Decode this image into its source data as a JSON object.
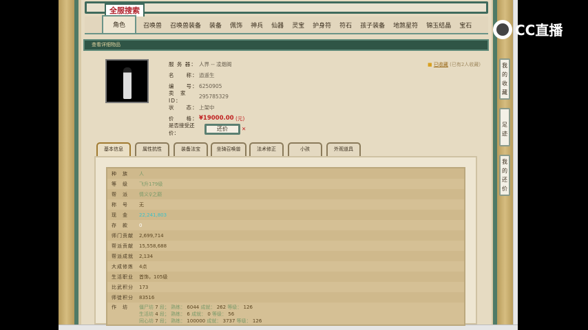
{
  "header": {
    "logo": "全服搜索"
  },
  "tabs": [
    "角色",
    "召唤兽",
    "召唤兽装备",
    "装备",
    "佩饰",
    "神兵",
    "仙器",
    "灵宝",
    "护身符",
    "符石",
    "孩子装备",
    "地煞星符",
    "锦玉结晶",
    "宝石"
  ],
  "active_tab": "角色",
  "section_title": "查看详细物品",
  "favorite": {
    "label": "已收藏",
    "count_text": "(已有2人收藏)"
  },
  "info": [
    {
      "key": "服 务 器：",
      "value": "人界 -- 凌烟阁"
    },
    {
      "key": "名　　称：",
      "value": "逍遥生"
    },
    {
      "key": "编　　号：",
      "value": "6250905"
    },
    {
      "key": "卖　家　ID：",
      "value": "295785329"
    },
    {
      "key": "状　　态：",
      "value": "上架中"
    },
    {
      "key": "价　　格：",
      "value": "¥19000.00",
      "unit": "(元)"
    },
    {
      "key": "是否接受还价：",
      "button": "还价"
    }
  ],
  "detail_tabs": [
    "基本信息",
    "属性抗性",
    "装备法宝",
    "坐骑召唤兽",
    "法术修正",
    "小孩",
    "外观道具"
  ],
  "active_detail_tab": "基本信息",
  "basic": [
    {
      "key": "种　族",
      "value": "人"
    },
    {
      "key": "等　级",
      "value": "飞升179级"
    },
    {
      "key": "帮　派",
      "value": "情义♀之巅"
    },
    {
      "key": "称　号",
      "value": "无"
    },
    {
      "key": "现　金",
      "value": "22,241,803"
    },
    {
      "key": "存　款",
      "value": "0"
    },
    {
      "key": "师门贡献",
      "value": "2,699,714"
    },
    {
      "key": "帮派贡献",
      "value": "15,558,688"
    },
    {
      "key": "帮派成就",
      "value": "2,134"
    },
    {
      "key": "大成修炼",
      "value": "4点"
    },
    {
      "key": "生活职业",
      "value": "首饰，105级"
    },
    {
      "key": "比武积分",
      "value": "173"
    },
    {
      "key": "师徒积分",
      "value": "83516"
    }
  ],
  "workshop": {
    "key": "作　坊",
    "lines": [
      [
        "僵尸坊",
        "7",
        "6044",
        "262",
        "126"
      ],
      [
        "生活坊",
        "4",
        "6",
        "0",
        "56"
      ],
      [
        "同心坊",
        "7",
        "100000",
        "3737",
        "126"
      ]
    ],
    "labels": {
      "grade": "段；",
      "skill": "熟练：",
      "achieve": "成就：",
      "level": "等级："
    }
  },
  "side_buttons": [
    "我的收藏",
    "足迹",
    "我的还价"
  ],
  "overlay": {
    "brand": "CC直播"
  },
  "colors": {
    "accent_green": "#2f5546",
    "price_red": "#c02020",
    "cash_cyan": "#3ac0c8"
  }
}
